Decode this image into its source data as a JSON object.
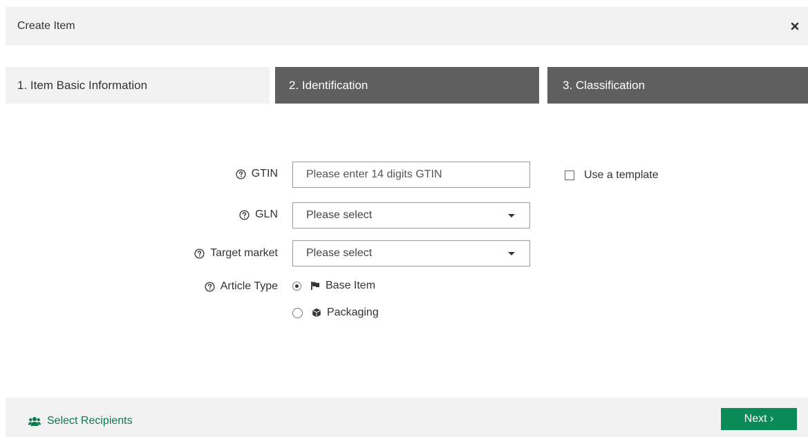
{
  "dialog": {
    "title": "Create Item",
    "close_icon": "close-icon"
  },
  "steps": [
    {
      "label": "1. Item Basic Information",
      "active": true
    },
    {
      "label": "2. Identification",
      "active": false
    },
    {
      "label": "3. Classification",
      "active": false
    }
  ],
  "form": {
    "gtin": {
      "label": "GTIN",
      "value": "",
      "placeholder": "Please enter 14 digits GTIN"
    },
    "gln": {
      "label": "GLN",
      "selected": "Please select"
    },
    "target_market": {
      "label": "Target market",
      "selected": "Please select"
    },
    "article_type": {
      "label": "Article Type",
      "options": [
        {
          "label": "Base Item",
          "icon": "flag-icon",
          "checked": true
        },
        {
          "label": "Packaging",
          "icon": "box-icon",
          "checked": false
        }
      ]
    },
    "template": {
      "label": "Use a template",
      "checked": false
    }
  },
  "footer": {
    "recipients_label": "Select Recipients",
    "next_label": "Next ›"
  },
  "colors": {
    "header_bg": "#f2f2f2",
    "step_inactive_bg": "#5f5f5f",
    "accent_green": "#098a57",
    "link_green": "#0b7a4b"
  }
}
